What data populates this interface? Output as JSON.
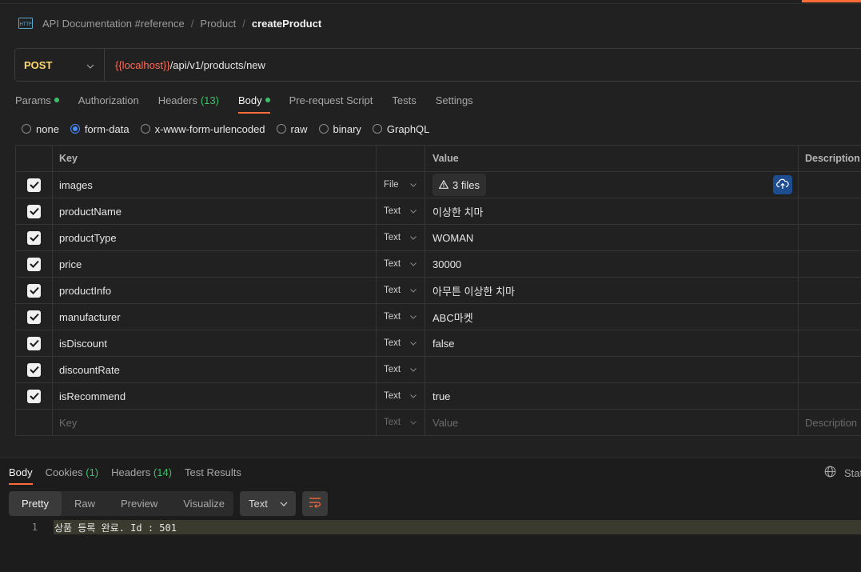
{
  "breadcrumb": {
    "items": [
      "API Documentation #reference",
      "Product"
    ],
    "current": "createProduct",
    "separator": "/"
  },
  "request": {
    "method": "POST",
    "url_variable": "{{localhost}}",
    "url_path": "/api/v1/products/new"
  },
  "tabs": {
    "params": "Params",
    "authorization": "Authorization",
    "headers": "Headers",
    "headers_count": "(13)",
    "body": "Body",
    "prerequest": "Pre-request Script",
    "tests": "Tests",
    "settings": "Settings"
  },
  "body_types": {
    "none": "none",
    "form_data": "form-data",
    "urlencoded": "x-www-form-urlencoded",
    "raw": "raw",
    "binary": "binary",
    "graphql": "GraphQL"
  },
  "table": {
    "headers": {
      "key": "Key",
      "value": "Value",
      "description": "Description"
    },
    "rows": [
      {
        "key": "images",
        "type": "File",
        "value": "3 files"
      },
      {
        "key": "productName",
        "type": "Text",
        "value": "이상한 치마"
      },
      {
        "key": "productType",
        "type": "Text",
        "value": "WOMAN"
      },
      {
        "key": "price",
        "type": "Text",
        "value": "30000"
      },
      {
        "key": "productInfo",
        "type": "Text",
        "value": "아무튼 이상한 치마"
      },
      {
        "key": "manufacturer",
        "type": "Text",
        "value": "ABC마켓"
      },
      {
        "key": "isDiscount",
        "type": "Text",
        "value": "false"
      },
      {
        "key": "discountRate",
        "type": "Text",
        "value": ""
      },
      {
        "key": "isRecommend",
        "type": "Text",
        "value": "true"
      }
    ],
    "placeholder": {
      "key": "Key",
      "type": "Text",
      "value": "Value",
      "description": "Description"
    }
  },
  "response": {
    "tabs": {
      "body": "Body",
      "cookies": "Cookies",
      "cookies_count": "(1)",
      "headers": "Headers",
      "headers_count": "(14)",
      "test_results": "Test Results"
    },
    "status_label": "Stat",
    "views": [
      "Pretty",
      "Raw",
      "Preview",
      "Visualize"
    ],
    "format": "Text",
    "line_number": "1",
    "line_text": "상품 등록 완료. Id : 501"
  },
  "colors": {
    "accent": "#ff6c37",
    "method": "#ffd86e",
    "url_variable": "#ff6b55",
    "count_green": "#3fbf6a",
    "radio_selected": "#4d8cff"
  }
}
